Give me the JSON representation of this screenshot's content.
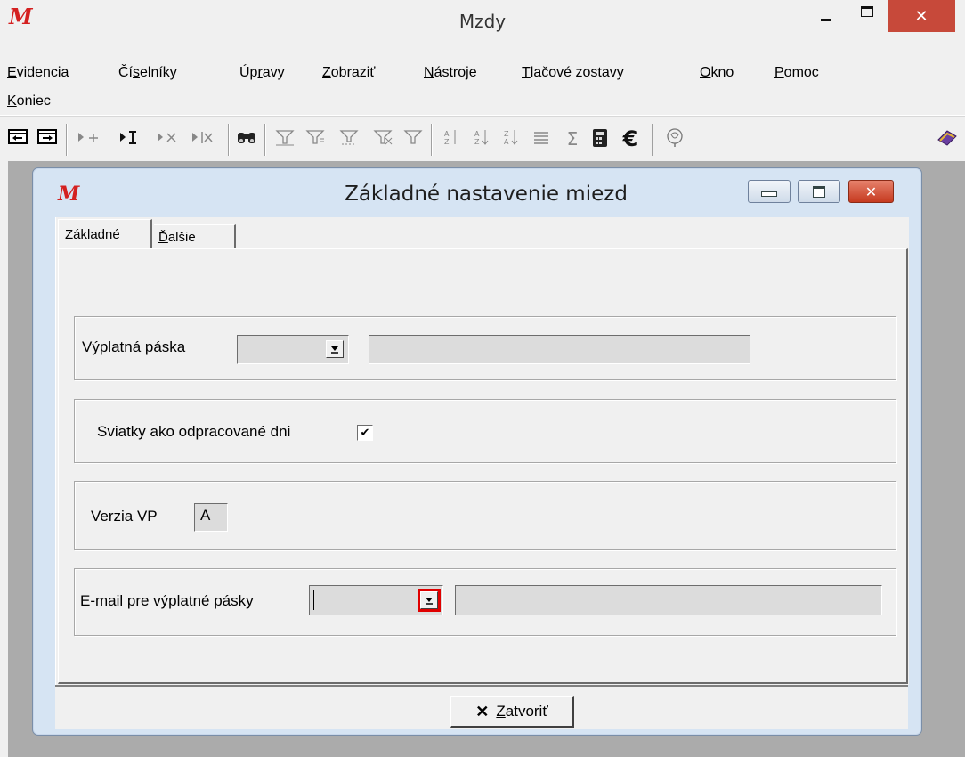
{
  "window": {
    "title": "Mzdy",
    "logo_glyph": "M",
    "minimize_glyph": "–",
    "close_glyph": "✕",
    "close_color": "#c7493a"
  },
  "menu": {
    "items": [
      {
        "key": "E",
        "rest": "videncia"
      },
      {
        "pre": "Čí",
        "key": "s",
        "rest": "elníky"
      },
      {
        "pre": "Úp",
        "key": "r",
        "rest": "avy"
      },
      {
        "key": "Z",
        "rest": "obraziť"
      },
      {
        "key": "N",
        "rest": "ástroje"
      },
      {
        "key": "T",
        "rest": "lačové zostavy"
      },
      {
        "key": "O",
        "rest": "kno"
      },
      {
        "key": "P",
        "rest": "omoc"
      },
      {
        "key": "K",
        "rest": "oniec"
      }
    ]
  },
  "toolbar": {
    "icons": [
      "record-first-icon",
      "record-last-icon",
      "record-add-icon",
      "record-insert-icon",
      "record-delete-icon",
      "record-cut-icon",
      "binoculars-icon",
      "filter-a-icon",
      "filter-b-icon",
      "filter-c-icon",
      "filter-d-icon",
      "filter-e-icon",
      "sort-az-icon",
      "sort-az2-icon",
      "sort-za-icon",
      "list-icon",
      "sum-icon",
      "calculator-icon",
      "euro-icon",
      "tree-icon",
      "book-icon"
    ],
    "sum_glyph": "Σ",
    "euro_glyph": "€"
  },
  "dialog": {
    "title": "Základné nastavenie miezd",
    "logo_glyph": "M",
    "accent": "#c00000",
    "tabs": [
      {
        "label": "Základné"
      },
      {
        "pre": "",
        "key": "Ď",
        "rest": "alšie"
      }
    ],
    "vyplatna_paska": {
      "label": "Výplatná páska",
      "value": "",
      "description": ""
    },
    "sviatky": {
      "label": "Sviatky ako odpracované dni",
      "checked": true,
      "check_glyph": "✔"
    },
    "verzia": {
      "label": "Verzia VP",
      "value": "A"
    },
    "email": {
      "label": "E-mail pre výplatné pásky",
      "value": "",
      "description": "",
      "highlight_color": "#e00000"
    },
    "close_button": {
      "glyph": "✕",
      "key": "Z",
      "rest": "atvoriť"
    }
  }
}
